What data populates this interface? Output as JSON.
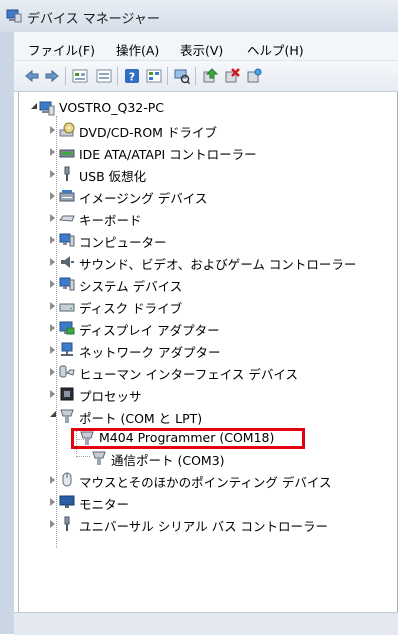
{
  "window": {
    "title": "デバイス マネージャー"
  },
  "menubar": {
    "items": [
      "ファイル(F)",
      "操作(A)",
      "表示(V)",
      "ヘルプ(H)"
    ]
  },
  "toolbar": {
    "buttons": [
      "back-icon",
      "forward-icon",
      "properties-grid-icon",
      "show-hidden-icon",
      "help-icon",
      "view-grid-icon",
      "scan-hardware-icon",
      "update-driver-icon",
      "uninstall-icon",
      "disable-icon"
    ]
  },
  "tree": {
    "root": "VOSTRO_Q32-PC",
    "nodes": [
      {
        "label": "DVD/CD-ROM ドライブ",
        "icon": "dvd-drive-icon"
      },
      {
        "label": "IDE ATA/ATAPI コントローラー",
        "icon": "ide-controller-icon"
      },
      {
        "label": "USB 仮想化",
        "icon": "usb-icon"
      },
      {
        "label": "イメージング デバイス",
        "icon": "imaging-device-icon"
      },
      {
        "label": "キーボード",
        "icon": "keyboard-icon"
      },
      {
        "label": "コンピューター",
        "icon": "computer-icon"
      },
      {
        "label": "サウンド、ビデオ、およびゲーム コントローラー",
        "icon": "speaker-icon"
      },
      {
        "label": "システム デバイス",
        "icon": "system-device-icon"
      },
      {
        "label": "ディスク ドライブ",
        "icon": "disk-drive-icon"
      },
      {
        "label": "ディスプレイ アダプター",
        "icon": "display-adapter-icon"
      },
      {
        "label": "ネットワーク アダプター",
        "icon": "network-adapter-icon"
      },
      {
        "label": "ヒューマン インターフェイス デバイス",
        "icon": "hid-icon"
      },
      {
        "label": "プロセッサ",
        "icon": "processor-icon"
      },
      {
        "label": "ポート (COM と LPT)",
        "icon": "port-icon",
        "expanded": true,
        "children": [
          {
            "label": "M404 Programmer (COM18)",
            "icon": "port-icon",
            "highlighted": true
          },
          {
            "label": "通信ポート (COM3)",
            "icon": "port-icon"
          }
        ]
      },
      {
        "label": "マウスとそのほかのポインティング デバイス",
        "icon": "mouse-icon"
      },
      {
        "label": "モニター",
        "icon": "monitor-icon"
      },
      {
        "label": "ユニバーサル シリアル バス コントローラー",
        "icon": "usb-controller-icon"
      }
    ]
  },
  "colors": {
    "highlight_border": "#e3000f",
    "frame": "#c9d6e6"
  }
}
